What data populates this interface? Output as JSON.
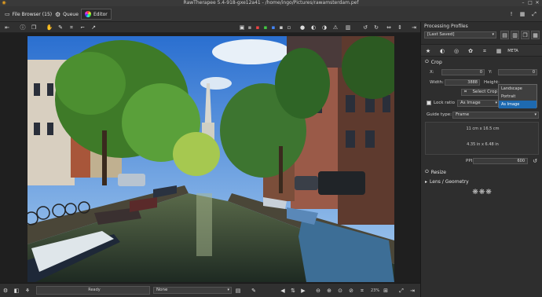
{
  "window": {
    "title": "RawTherapee 5.4-918-gxe12a41 - /home/ingo/Pictures/rawamsterdam.pef"
  },
  "tabs": [
    {
      "label": "File Browser (15)",
      "icon": "folder-icon"
    },
    {
      "label": "Queue",
      "icon": "gears-icon"
    },
    {
      "label": "Editor",
      "icon": "color-wheel-icon"
    }
  ],
  "right_panel": {
    "title": "Processing Profiles",
    "profile_value": "[Last Saved]",
    "crop": {
      "section_label": "Crop",
      "x_label": "X:",
      "x_value": "0",
      "y_label": "Y:",
      "y_value": "0",
      "width_label": "Width:",
      "width_value": "3888",
      "height_label": "Height:",
      "select_crop_label": "Select Crop",
      "lock_ratio_label": "Lock ratio",
      "lock_ratio_value": "As Image",
      "orientation_options": [
        "Landscape",
        "Portrait",
        "As Image"
      ],
      "orientation_selected": "As Image",
      "guide_type_label": "Guide type:",
      "guide_type_value": "Frame",
      "size_cm": "11 cm x 16.5 cm",
      "size_in": "4.35 in x 6.48 in",
      "ppi_label": "PPI:",
      "ppi_value": "600"
    },
    "resize_label": "Resize",
    "lens_label": "Lens / Geometry"
  },
  "status": {
    "ready_text": "Ready",
    "none_text": "None",
    "zoom_value": "23%"
  },
  "colors": {
    "selected": "#1e6ab0",
    "panel_bg": "#2e2e2e",
    "canvas_bg": "#1f1f1f"
  }
}
